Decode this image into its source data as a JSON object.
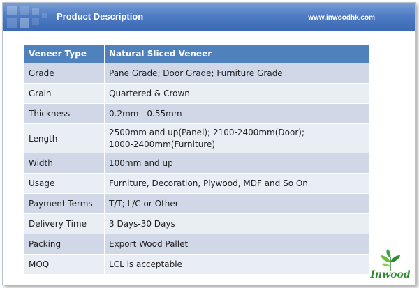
{
  "header": {
    "title": "Product Description",
    "url": "www.inwoodhk.com"
  },
  "table": {
    "header": [
      "Veneer Type",
      "Natural Sliced Veneer"
    ],
    "rows": [
      {
        "label": "Grade",
        "value": "Pane Grade; Door Grade; Furniture Grade"
      },
      {
        "label": "Grain",
        "value": "Quartered & Crown"
      },
      {
        "label": "Thickness",
        "value": "0.2mm - 0.55mm"
      },
      {
        "label": "Length",
        "value": "2500mm and up(Panel); 2100-2400mm(Door);",
        "value2": "1000-2400mm(Furniture)"
      },
      {
        "label": "Width",
        "value": "100mm and up"
      },
      {
        "label": "Usage",
        "value": "Furniture, Decoration, Plywood, MDF and So On"
      },
      {
        "label": "Payment Terms",
        "value": "T/T; L/C or Other"
      },
      {
        "label": "Delivery Time",
        "value": "3 Days-30 Days"
      },
      {
        "label": "Packing",
        "value": "Export Wood Pallet"
      },
      {
        "label": "MOQ",
        "value": "LCL is acceptable"
      }
    ]
  },
  "logo": {
    "text": "Inwood"
  },
  "colors": {
    "header_bar": "#4f7cc4",
    "table_header": "#4f81bd",
    "row_odd": "#d0d8e8",
    "row_even": "#e9edf4",
    "logo_green": "#2e8a2e"
  }
}
